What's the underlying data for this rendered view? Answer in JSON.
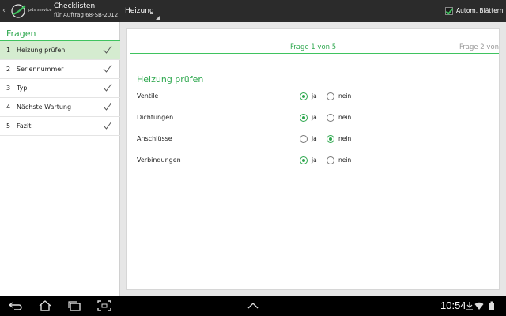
{
  "actionbar": {
    "logo_text": "pds service",
    "title": "Checklisten",
    "subtitle": "für Auftrag 68-SB-2012",
    "spinner_label": "Heizung",
    "auto_label": "Autom. Blättern",
    "auto_checked": true
  },
  "sidebar": {
    "header": "Fragen",
    "items": [
      {
        "num": "1",
        "label": "Heizung prüfen",
        "active": true
      },
      {
        "num": "2",
        "label": "Seriennummer",
        "active": false
      },
      {
        "num": "3",
        "label": "Typ",
        "active": false
      },
      {
        "num": "4",
        "label": "Nächste Wartung",
        "active": false
      },
      {
        "num": "5",
        "label": "Fazit",
        "active": false
      }
    ]
  },
  "main": {
    "pager_current": "Frage 1 von 5",
    "pager_next": "Frage 2 von",
    "section_title": "Heizung prüfen",
    "yes_label": "ja",
    "no_label": "nein",
    "questions": [
      {
        "label": "Ventile",
        "answer": "ja"
      },
      {
        "label": "Dichtungen",
        "answer": "ja"
      },
      {
        "label": "Anschlüsse",
        "answer": "nein"
      },
      {
        "label": "Verbindungen",
        "answer": "ja"
      }
    ]
  },
  "navbar": {
    "time": "10:54",
    "icons": [
      "back-icon",
      "home-icon",
      "recent-apps-icon",
      "screenshot-icon",
      "up-arrow-icon",
      "download-icon",
      "wifi-icon",
      "battery-icon"
    ]
  },
  "colors": {
    "accent": "#2fa84f",
    "accent_line": "#3fc35f",
    "active_row": "#d5ecd0",
    "actionbar": "#2b2b2b"
  }
}
